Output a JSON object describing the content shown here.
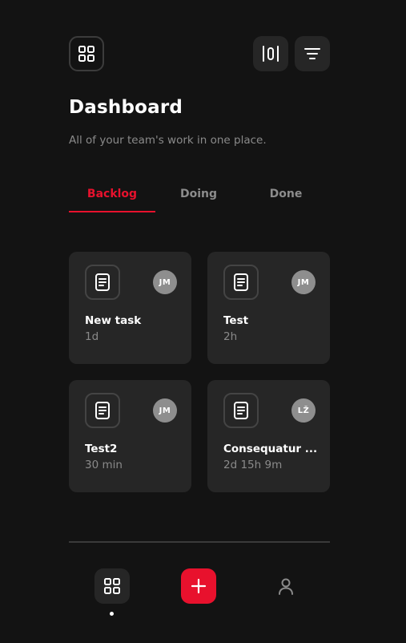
{
  "header": {
    "title": "Dashboard",
    "subtitle": "All of your team's work in one place.",
    "icons": [
      "grid-icon",
      "columns-icon",
      "filter-icon"
    ]
  },
  "tabs": [
    {
      "label": "Backlog",
      "active": true
    },
    {
      "label": "Doing",
      "active": false
    },
    {
      "label": "Done",
      "active": false
    }
  ],
  "cards": [
    {
      "title": "New task",
      "time": "1d",
      "assignee": "JM",
      "icon": "document-icon"
    },
    {
      "title": "Test",
      "time": "2h",
      "assignee": "JM",
      "icon": "document-icon"
    },
    {
      "title": "Test2",
      "time": "30 min",
      "assignee": "JM",
      "icon": "document-icon"
    },
    {
      "title": "Consequatur ...",
      "time": "2d 15h 9m",
      "assignee": "LŽ",
      "icon": "document-icon"
    }
  ],
  "bottom_nav": {
    "items": [
      "grid-icon",
      "plus-icon",
      "user-icon"
    ],
    "active": "grid-icon"
  },
  "colors": {
    "background": "#131313",
    "card": "#262626",
    "accent": "#e8112d",
    "muted_text": "#8a8a8a"
  }
}
